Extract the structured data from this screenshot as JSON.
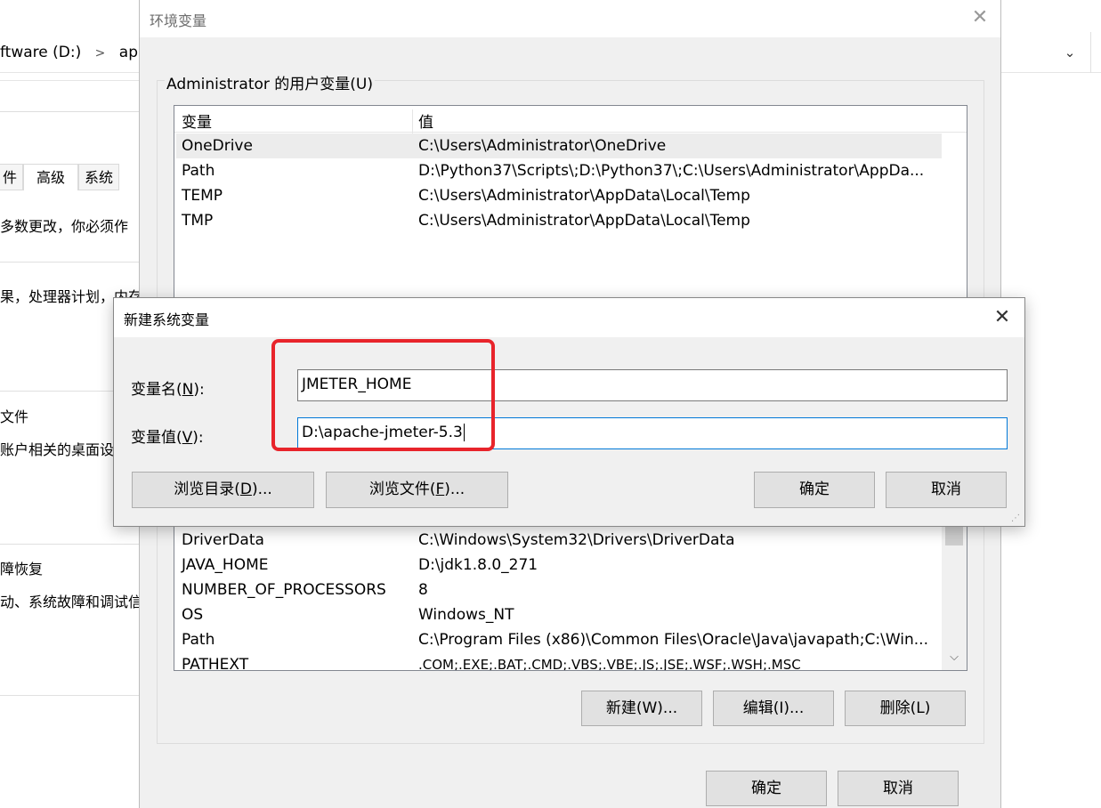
{
  "explorer": {
    "address": [
      "ftware (D:)",
      ">",
      "apa"
    ],
    "chevron": "⌄"
  },
  "system_properties": {
    "tabs": [
      "硬件",
      "高级",
      "系统保护"
    ],
    "visible_tabs": [
      "件",
      "高级",
      "系统"
    ],
    "notice": "多数更改，你必须作",
    "perf_text": "果，处理器计划，内存",
    "profile_heading": "文件",
    "profile_text": "账户相关的桌面设",
    "recovery_heading": "障恢复",
    "recovery_text": "动、系统故障和调试信"
  },
  "env_dialog": {
    "title": "环境变量",
    "user_group_label": "Administrator 的用户变量(U)",
    "columns": [
      "变量",
      "值"
    ],
    "user_vars": [
      {
        "name": "OneDrive",
        "value": "C:\\Users\\Administrator\\OneDrive",
        "selected": true
      },
      {
        "name": "Path",
        "value": "D:\\Python37\\Scripts\\;D:\\Python37\\;C:\\Users\\Administrator\\AppDa..."
      },
      {
        "name": "TEMP",
        "value": "C:\\Users\\Administrator\\AppData\\Local\\Temp"
      },
      {
        "name": "TMP",
        "value": "C:\\Users\\Administrator\\AppData\\Local\\Temp"
      }
    ],
    "system_vars": [
      {
        "name": "DriverData",
        "value": "C:\\Windows\\System32\\Drivers\\DriverData"
      },
      {
        "name": "JAVA_HOME",
        "value": "D:\\jdk1.8.0_271"
      },
      {
        "name": "NUMBER_OF_PROCESSORS",
        "value": "8"
      },
      {
        "name": "OS",
        "value": "Windows_NT"
      },
      {
        "name": "Path",
        "value": "C:\\Program Files (x86)\\Common Files\\Oracle\\Java\\javapath;C:\\Win..."
      },
      {
        "name": "PATHEXT",
        "value": ".COM;.EXE;.BAT;.CMD;.VBS;.VBE;.JS;.JSE;.WSF;.WSH;.MSC"
      }
    ],
    "system_buttons": {
      "new": "新建(W)...",
      "edit": "编辑(I)...",
      "delete": "删除(L)"
    },
    "ok": "确定",
    "cancel": "取消"
  },
  "new_var_dialog": {
    "title": "新建系统变量",
    "name_label": "变量名(N):",
    "name_label_pre": "变量名(",
    "name_label_key": "N",
    "name_label_post": "):",
    "value_label_pre": "变量值(",
    "value_label_key": "V",
    "value_label_post": "):",
    "name_value": "JMETER_HOME",
    "value_value": "D:\\apache-jmeter-5.3",
    "browse_dir_pre": "浏览目录(",
    "browse_dir_key": "D",
    "browse_dir_post": ")...",
    "browse_file_pre": "浏览文件(",
    "browse_file_key": "F",
    "browse_file_post": ")...",
    "ok": "确定",
    "cancel": "取消"
  },
  "colors": {
    "highlight": "#e8242b",
    "focus": "#0078d7",
    "dialog_bg": "#f0f0f0"
  }
}
